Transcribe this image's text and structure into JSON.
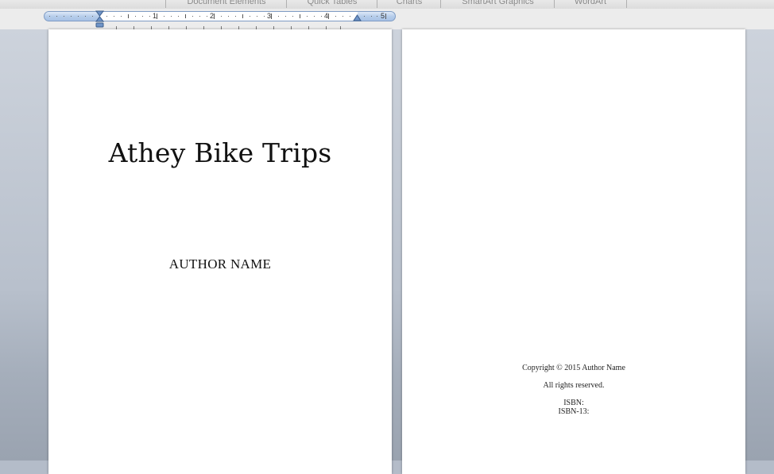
{
  "ribbon": {
    "tabs": [
      {
        "label": "Document Elements"
      },
      {
        "label": "Quick Tables"
      },
      {
        "label": "Charts"
      },
      {
        "label": "SmartArt Graphics"
      },
      {
        "label": "WordArt"
      }
    ]
  },
  "ruler": {
    "numbers": [
      "1",
      "2",
      "3",
      "4",
      "5"
    ],
    "icons": {
      "first_line_indent": "first-line-indent-marker",
      "right_indent": "right-indent-marker"
    }
  },
  "page1": {
    "title": "Athey Bike Trips",
    "author": "AUTHOR NAME"
  },
  "page2": {
    "copyright": "Copyright © 2015 Author Name",
    "rights": "All rights reserved.",
    "isbn": "ISBN:",
    "isbn13": "ISBN-13:"
  },
  "colors": {
    "workspace": "#b4bcc9",
    "ruler_track": "#b6cdea",
    "page": "#ffffff"
  }
}
